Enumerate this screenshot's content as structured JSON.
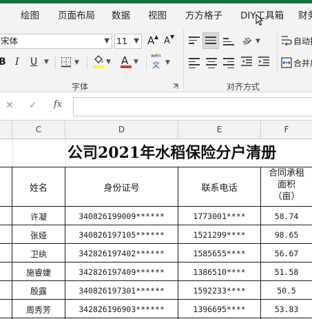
{
  "ribbon": {
    "tabs": [
      "绘图",
      "页面布局",
      "数据",
      "视图",
      "方方格子",
      "DIY工具箱",
      "财务"
    ],
    "font_name": "宋体",
    "font_size": "11",
    "grow_font": "A",
    "shrink_font": "A",
    "bold": "B",
    "italic": "I",
    "underline": "U",
    "font_color_letter": "A",
    "wen_label": "wén",
    "wen_char": "文",
    "auto_wrap": "自动换",
    "merge_center": "合并后",
    "font_group_label": "字体",
    "align_group_label": "对齐方式",
    "highlight_color": "#ffff00",
    "font_color": "#e03131"
  },
  "formula_bar": {
    "cancel": "✕",
    "confirm": "✓",
    "fx": "fx",
    "value": ""
  },
  "columns": [
    "C",
    "D",
    "E",
    "F"
  ],
  "sheet": {
    "title": "公司2021年水稻保险分户清册",
    "headers": {
      "name": "姓名",
      "id": "身份证号",
      "phone": "联系电话",
      "area_line1": "合同承租",
      "area_line2": "面积",
      "area_line3": "（亩）"
    },
    "rows": [
      {
        "name": "许凝",
        "id": "340826199009******",
        "phone": "1773001****",
        "area": "58.74"
      },
      {
        "name": "张娅",
        "id": "340826197105******",
        "phone": "1521299****",
        "area": "98.65"
      },
      {
        "name": "卫纨",
        "id": "342826197402******",
        "phone": "1585655****",
        "area": "56.67"
      },
      {
        "name": "施睿婕",
        "id": "342826197409******",
        "phone": "1386510****",
        "area": "51.58"
      },
      {
        "name": "殷露",
        "id": "340826197301******",
        "phone": "1592233****",
        "area": "50.5"
      },
      {
        "name": "周秀芳",
        "id": "342826196903******",
        "phone": "1396695****",
        "area": "53.83"
      }
    ]
  }
}
